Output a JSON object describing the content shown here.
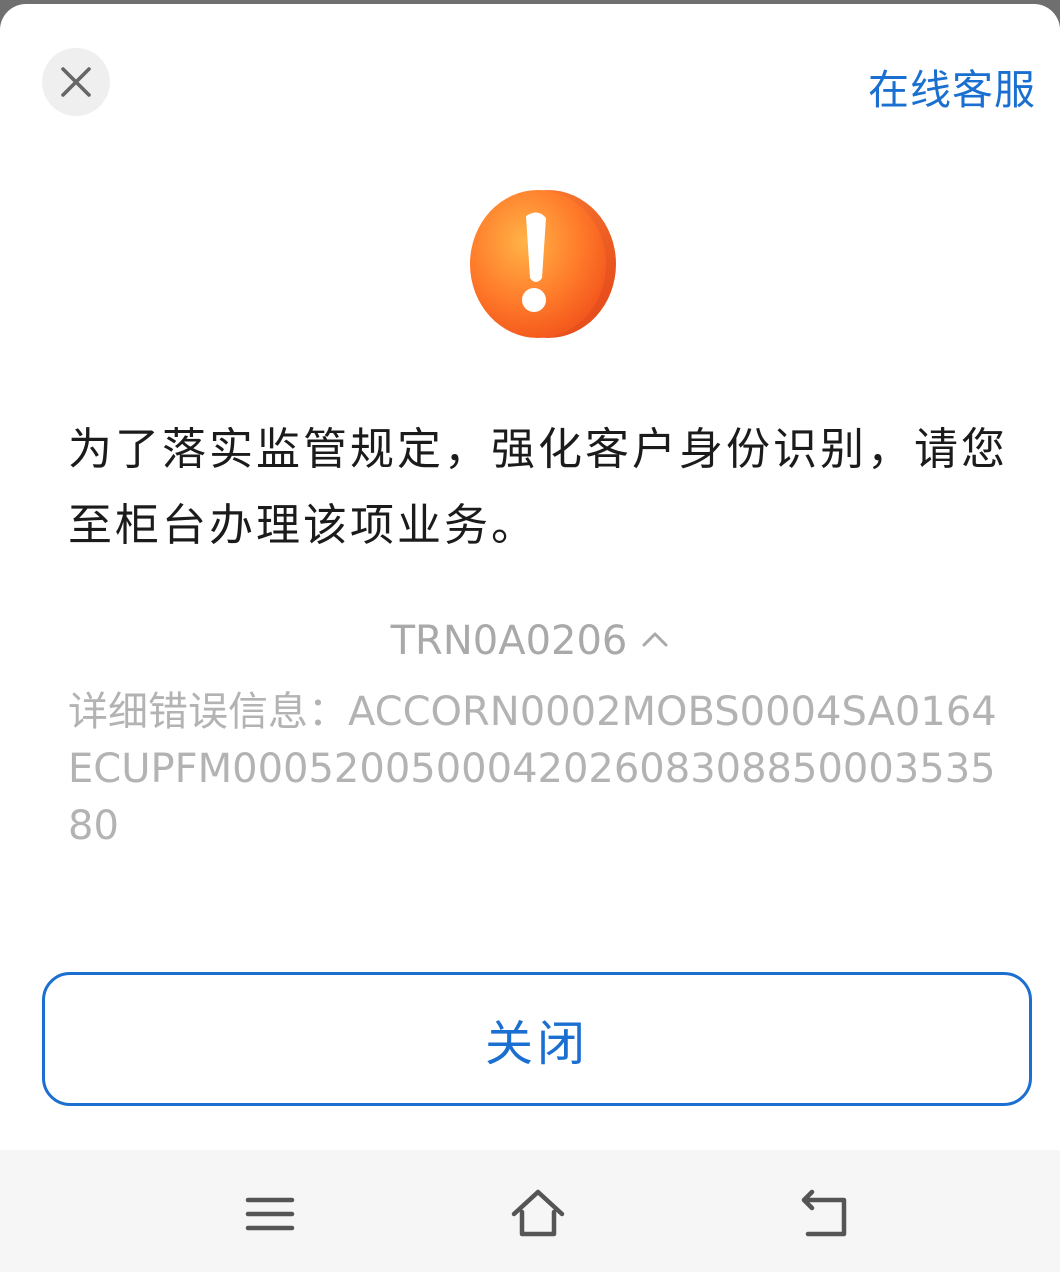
{
  "header": {
    "close_icon": "close-icon",
    "service_link": "在线客服"
  },
  "alert": {
    "icon": "warning-exclamation-icon",
    "icon_colors": [
      "#ff9a3c",
      "#ff5a1f"
    ],
    "message": "为了落实监管规定，强化客户身份识别，请您至柜台办理该项业务。",
    "error_code": "TRN0A0206",
    "toggle_icon": "chevron-up-icon",
    "detail_label": "详细错误信息：",
    "detail_value": "ACCORN0002MOBS0004SA0164ECUPFM00052005000420260830885000353580"
  },
  "actions": {
    "close_label": "关闭"
  },
  "navbar": {
    "items": [
      "menu-icon",
      "home-icon",
      "back-icon"
    ]
  },
  "colors": {
    "accent": "#1a6fd0",
    "muted_text": "#a9a9a9",
    "body_text": "#1b1b1b"
  }
}
